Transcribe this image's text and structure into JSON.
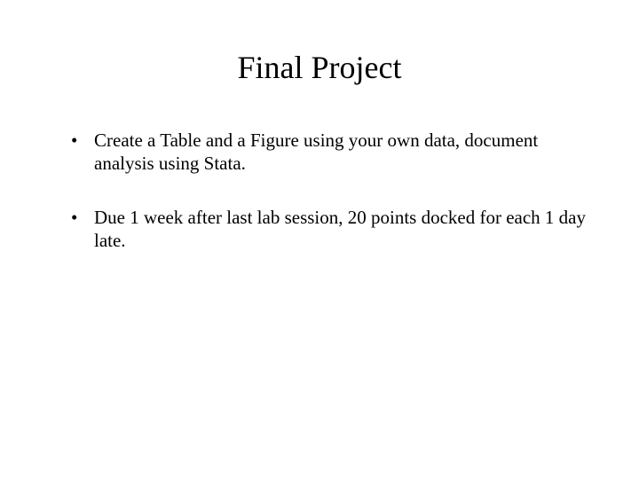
{
  "slide": {
    "title": "Final Project",
    "bullets": [
      "Create a Table and a Figure using your own data, document analysis using Stata.",
      "Due 1 week after last lab session, 20 points docked for each 1 day late."
    ]
  }
}
